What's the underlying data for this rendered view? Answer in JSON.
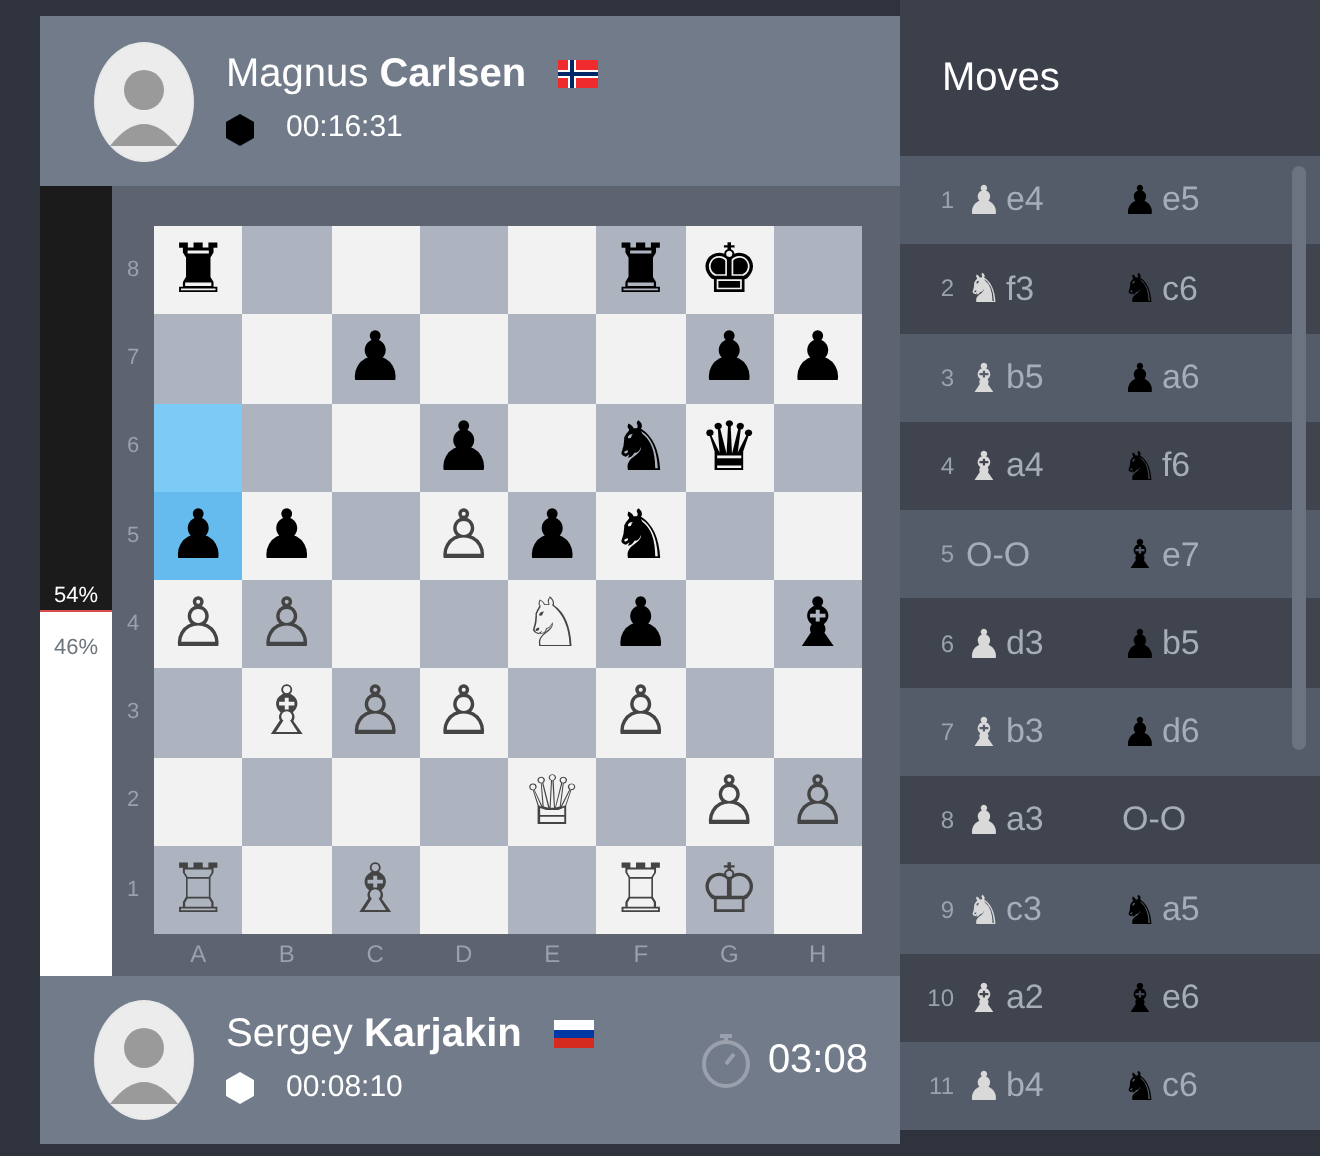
{
  "top_player": {
    "name": "Magnus **Carlsen**",
    "flag": {
      "kind": "norway"
    },
    "kind": "black",
    "clock": "00:16:31"
  },
  "evaluation": {
    "level": 0.54,
    "black_label": "54%",
    "white_label": "46%"
  },
  "board": {
    "rank_labels": [
      "8",
      "7",
      "6",
      "5",
      "4",
      "3",
      "2",
      "1"
    ],
    "file_labels": [
      "A",
      "B",
      "C",
      "D",
      "E",
      "F",
      "G",
      "H"
    ],
    "ranks": [
      [
        {
          "piece": "♜",
          "kind": "black",
          "highlighted": false
        },
        {
          "highlighted": false
        },
        {
          "highlighted": false
        },
        {
          "highlighted": false
        },
        {
          "highlighted": false
        },
        {
          "piece": "♜",
          "kind": "black",
          "highlighted": false
        },
        {
          "piece": "♚",
          "kind": "black",
          "highlighted": false
        },
        {
          "highlighted": false
        }
      ],
      [
        {
          "highlighted": false
        },
        {
          "highlighted": false
        },
        {
          "piece": "♟",
          "kind": "black",
          "highlighted": false
        },
        {
          "highlighted": false
        },
        {
          "highlighted": false
        },
        {
          "highlighted": false
        },
        {
          "piece": "♟",
          "kind": "black",
          "highlighted": false
        },
        {
          "piece": "♟",
          "kind": "black",
          "highlighted": false
        }
      ],
      [
        {
          "highlighted": true
        },
        {
          "highlighted": false
        },
        {
          "highlighted": false
        },
        {
          "piece": "♟",
          "kind": "black",
          "highlighted": false
        },
        {
          "highlighted": false
        },
        {
          "piece": "♞",
          "kind": "black",
          "highlighted": false
        },
        {
          "piece": "♛",
          "kind": "black",
          "highlighted": false
        },
        {
          "highlighted": false
        }
      ],
      [
        {
          "piece": "♟",
          "kind": "black",
          "highlighted": true
        },
        {
          "piece": "♟",
          "kind": "black",
          "highlighted": false
        },
        {
          "highlighted": false
        },
        {
          "piece": "♙",
          "kind": "white",
          "highlighted": false
        },
        {
          "piece": "♟",
          "kind": "black",
          "highlighted": false
        },
        {
          "piece": "♞",
          "kind": "black",
          "highlighted": false
        },
        {
          "highlighted": false
        },
        {
          "highlighted": false
        }
      ],
      [
        {
          "piece": "♙",
          "kind": "white",
          "highlighted": false
        },
        {
          "piece": "♙",
          "kind": "white",
          "highlighted": false
        },
        {
          "highlighted": false
        },
        {
          "highlighted": false
        },
        {
          "piece": "♘",
          "kind": "white",
          "highlighted": false
        },
        {
          "piece": "♟",
          "kind": "black",
          "highlighted": false
        },
        {
          "highlighted": false
        },
        {
          "piece": "♝",
          "kind": "black",
          "highlighted": false
        }
      ],
      [
        {
          "highlighted": false
        },
        {
          "piece": "♗",
          "kind": "white",
          "highlighted": false
        },
        {
          "piece": "♙",
          "kind": "white",
          "highlighted": false
        },
        {
          "piece": "♙",
          "kind": "white",
          "highlighted": false
        },
        {
          "highlighted": false
        },
        {
          "piece": "♙",
          "kind": "white",
          "highlighted": false
        },
        {
          "highlighted": false
        },
        {
          "highlighted": false
        }
      ],
      [
        {
          "highlighted": false
        },
        {
          "highlighted": false
        },
        {
          "highlighted": false
        },
        {
          "highlighted": false
        },
        {
          "piece": "♕",
          "kind": "white",
          "highlighted": false
        },
        {
          "highlighted": false
        },
        {
          "piece": "♙",
          "kind": "white",
          "highlighted": false
        },
        {
          "piece": "♙",
          "kind": "white",
          "highlighted": false
        }
      ],
      [
        {
          "piece": "♖",
          "kind": "white",
          "highlighted": false
        },
        {
          "highlighted": false
        },
        {
          "piece": "♗",
          "kind": "white",
          "highlighted": false
        },
        {
          "highlighted": false
        },
        {
          "highlighted": false
        },
        {
          "piece": "♖",
          "kind": "white",
          "highlighted": false
        },
        {
          "piece": "♔",
          "kind": "white",
          "highlighted": false
        },
        {
          "highlighted": false
        }
      ]
    ]
  },
  "bottom_player": {
    "name": "Sergey **Karjakin**",
    "flag": {
      "kind": "russia"
    },
    "kind": "white",
    "clock": "00:08:10",
    "move_timer": "03:08"
  },
  "moves_panel": {
    "title": "Moves",
    "moves": [
      {
        "number": "1",
        "white": {
          "piece": "♟",
          "san": "e4"
        },
        "black": {
          "piece": "♟",
          "san": "e5"
        }
      },
      {
        "number": "2",
        "white": {
          "piece": "♞",
          "san": "f3"
        },
        "black": {
          "piece": "♞",
          "san": "c6"
        }
      },
      {
        "number": "3",
        "white": {
          "piece": "♝",
          "san": "b5"
        },
        "black": {
          "piece": "♟",
          "san": "a6"
        }
      },
      {
        "number": "4",
        "white": {
          "piece": "♝",
          "san": "a4"
        },
        "black": {
          "piece": "♞",
          "san": "f6"
        }
      },
      {
        "number": "5",
        "white": {
          "san": "O-O"
        },
        "black": {
          "piece": "♝",
          "san": "e7"
        }
      },
      {
        "number": "6",
        "white": {
          "piece": "♟",
          "san": "d3"
        },
        "black": {
          "piece": "♟",
          "san": "b5"
        }
      },
      {
        "number": "7",
        "white": {
          "piece": "♝",
          "san": "b3"
        },
        "black": {
          "piece": "♟",
          "san": "d6"
        }
      },
      {
        "number": "8",
        "white": {
          "piece": "♟",
          "san": "a3"
        },
        "black": {
          "san": "O-O"
        }
      },
      {
        "number": "9",
        "white": {
          "piece": "♞",
          "san": "c3"
        },
        "black": {
          "piece": "♞",
          "san": "a5"
        }
      },
      {
        "number": "10",
        "white": {
          "piece": "♝",
          "san": "a2"
        },
        "black": {
          "piece": "♝",
          "san": "e6"
        }
      },
      {
        "number": "11",
        "white": {
          "piece": "♟",
          "san": "b4"
        },
        "black": {
          "piece": "♞",
          "san": "c6"
        }
      }
    ]
  }
}
